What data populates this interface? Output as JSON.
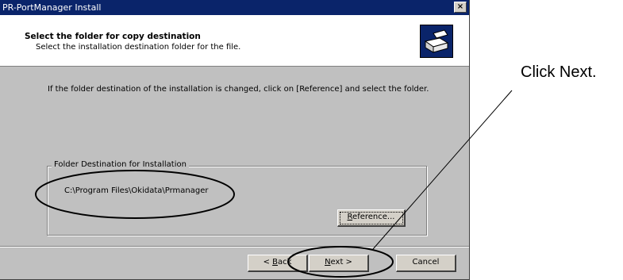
{
  "window": {
    "title": "PR-PortManager Install",
    "close_glyph": "×"
  },
  "header": {
    "title": "Select the folder for copy destination",
    "subtitle": "Select the installation destination folder for the file.",
    "icon": "installer-box-icon"
  },
  "content": {
    "instruction": "If the folder destination of the installation is changed, click on [Reference] and select the folder."
  },
  "group": {
    "legend": "Folder Destination for Installation",
    "path": "C:\\Program Files\\Okidata\\Prmanager"
  },
  "buttons": {
    "reference_pre": "",
    "reference_accel": "R",
    "reference_post": "eference...",
    "back_pre": "< ",
    "back_accel": "B",
    "back_post": "ack",
    "next_accel": "N",
    "next_post": "ext >",
    "cancel": "Cancel"
  },
  "annotation": {
    "text": "Click Next."
  },
  "colors": {
    "titlebar": "#0a246a",
    "dialog_bg": "#c0c0c0",
    "header_bg": "#ffffff"
  }
}
